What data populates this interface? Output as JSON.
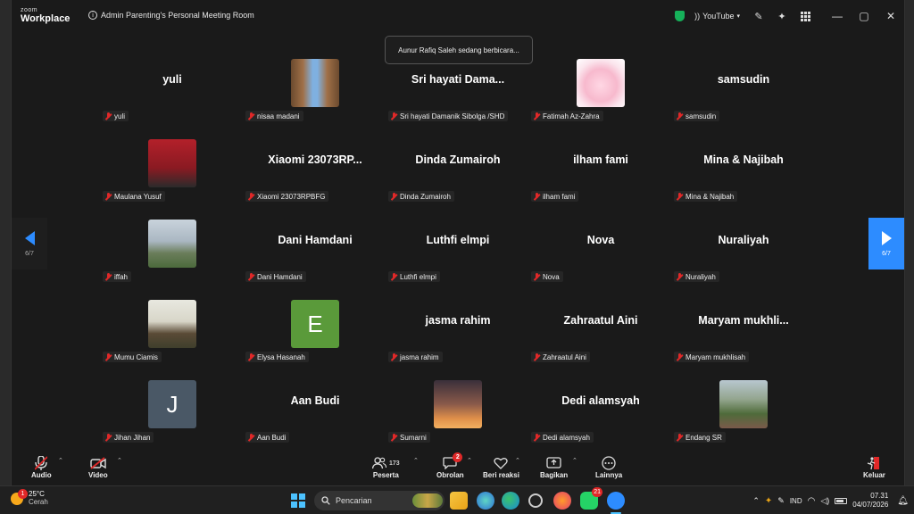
{
  "app": {
    "logo_small": "zoom",
    "logo_big": "Workplace",
    "meeting_title": "Admin Parenting's Personal Meeting Room",
    "stream_label": "YouTube",
    "speaking_banner": "Aunur Rafiq Saleh sedang berbicara...",
    "pager_label": "6/7"
  },
  "participants": [
    {
      "display": "yuli",
      "label": "yuli",
      "avatar": null
    },
    {
      "display": "",
      "label": "nisaa madani",
      "avatar": "photo-canyon"
    },
    {
      "display": "Sri hayati Dama...",
      "label": "Sri hayati Damanik Sibolga /SHD",
      "avatar": null
    },
    {
      "display": "",
      "label": "Fatimah Az-Zahra",
      "avatar": "photo-pink"
    },
    {
      "display": "samsudin",
      "label": "samsudin",
      "avatar": null
    },
    {
      "display": "",
      "label": "Maulana Yusuf",
      "avatar": "photo-red"
    },
    {
      "display": "Xiaomi 23073RP...",
      "label": "Xiaomi 23073RPBFG",
      "avatar": null
    },
    {
      "display": "Dinda Zumairoh",
      "label": "Dinda Zumairoh",
      "avatar": null
    },
    {
      "display": "ilham fami",
      "label": "ilham fami",
      "avatar": null
    },
    {
      "display": "Mina & Najibah",
      "label": "Mina & Najibah",
      "avatar": null
    },
    {
      "display": "",
      "label": "iffah",
      "avatar": "photo-city"
    },
    {
      "display": "Dani Hamdani",
      "label": "Dani Hamdani",
      "avatar": null
    },
    {
      "display": "Luthfi elmpi",
      "label": "Luthfi elmpi",
      "avatar": null
    },
    {
      "display": "Nova",
      "label": "Nova",
      "avatar": null
    },
    {
      "display": "Nuraliyah",
      "label": "Nuraliyah",
      "avatar": null
    },
    {
      "display": "",
      "label": "Mumu Ciamis",
      "avatar": "photo-man"
    },
    {
      "display": "",
      "label": "Elysa Hasanah",
      "avatar": "letter",
      "letter": "E",
      "color": "#5a9a3a"
    },
    {
      "display": "jasma rahim",
      "label": "jasma rahim",
      "avatar": null
    },
    {
      "display": "Zahraatul Aini",
      "label": "Zahraatul Aini",
      "avatar": null
    },
    {
      "display": "Maryam mukhli...",
      "label": "Maryam mukhlisah",
      "avatar": null
    },
    {
      "display": "",
      "label": "Jihan Jihan",
      "avatar": "letter",
      "letter": "J",
      "color": "#4a5866"
    },
    {
      "display": "Aan Budi",
      "label": "Aan Budi",
      "avatar": null
    },
    {
      "display": "",
      "label": "Sumarni",
      "avatar": "photo-sunset"
    },
    {
      "display": "Dedi alamsyah",
      "label": "Dedi alamsyah",
      "avatar": null
    },
    {
      "display": "",
      "label": "Endang SR",
      "avatar": "photo-group"
    }
  ],
  "toolbar": {
    "audio": "Audio",
    "video": "Video",
    "participants": "Peserta",
    "participants_count": "173",
    "chat": "Obrolan",
    "chat_badge": "2",
    "reactions": "Beri reaksi",
    "share": "Bagikan",
    "more": "Lainnya",
    "leave": "Keluar"
  },
  "taskbar": {
    "temperature": "25°C",
    "weather": "Cerah",
    "weather_badge": "1",
    "search_placeholder": "Pencarian",
    "whatsapp_badge": "21",
    "language": "IND",
    "time": "07.31",
    "date": "04/07/2026"
  },
  "colors": {
    "accent": "#2d8cff",
    "muted_red": "#e02828",
    "secure_green": "#16b15a"
  }
}
